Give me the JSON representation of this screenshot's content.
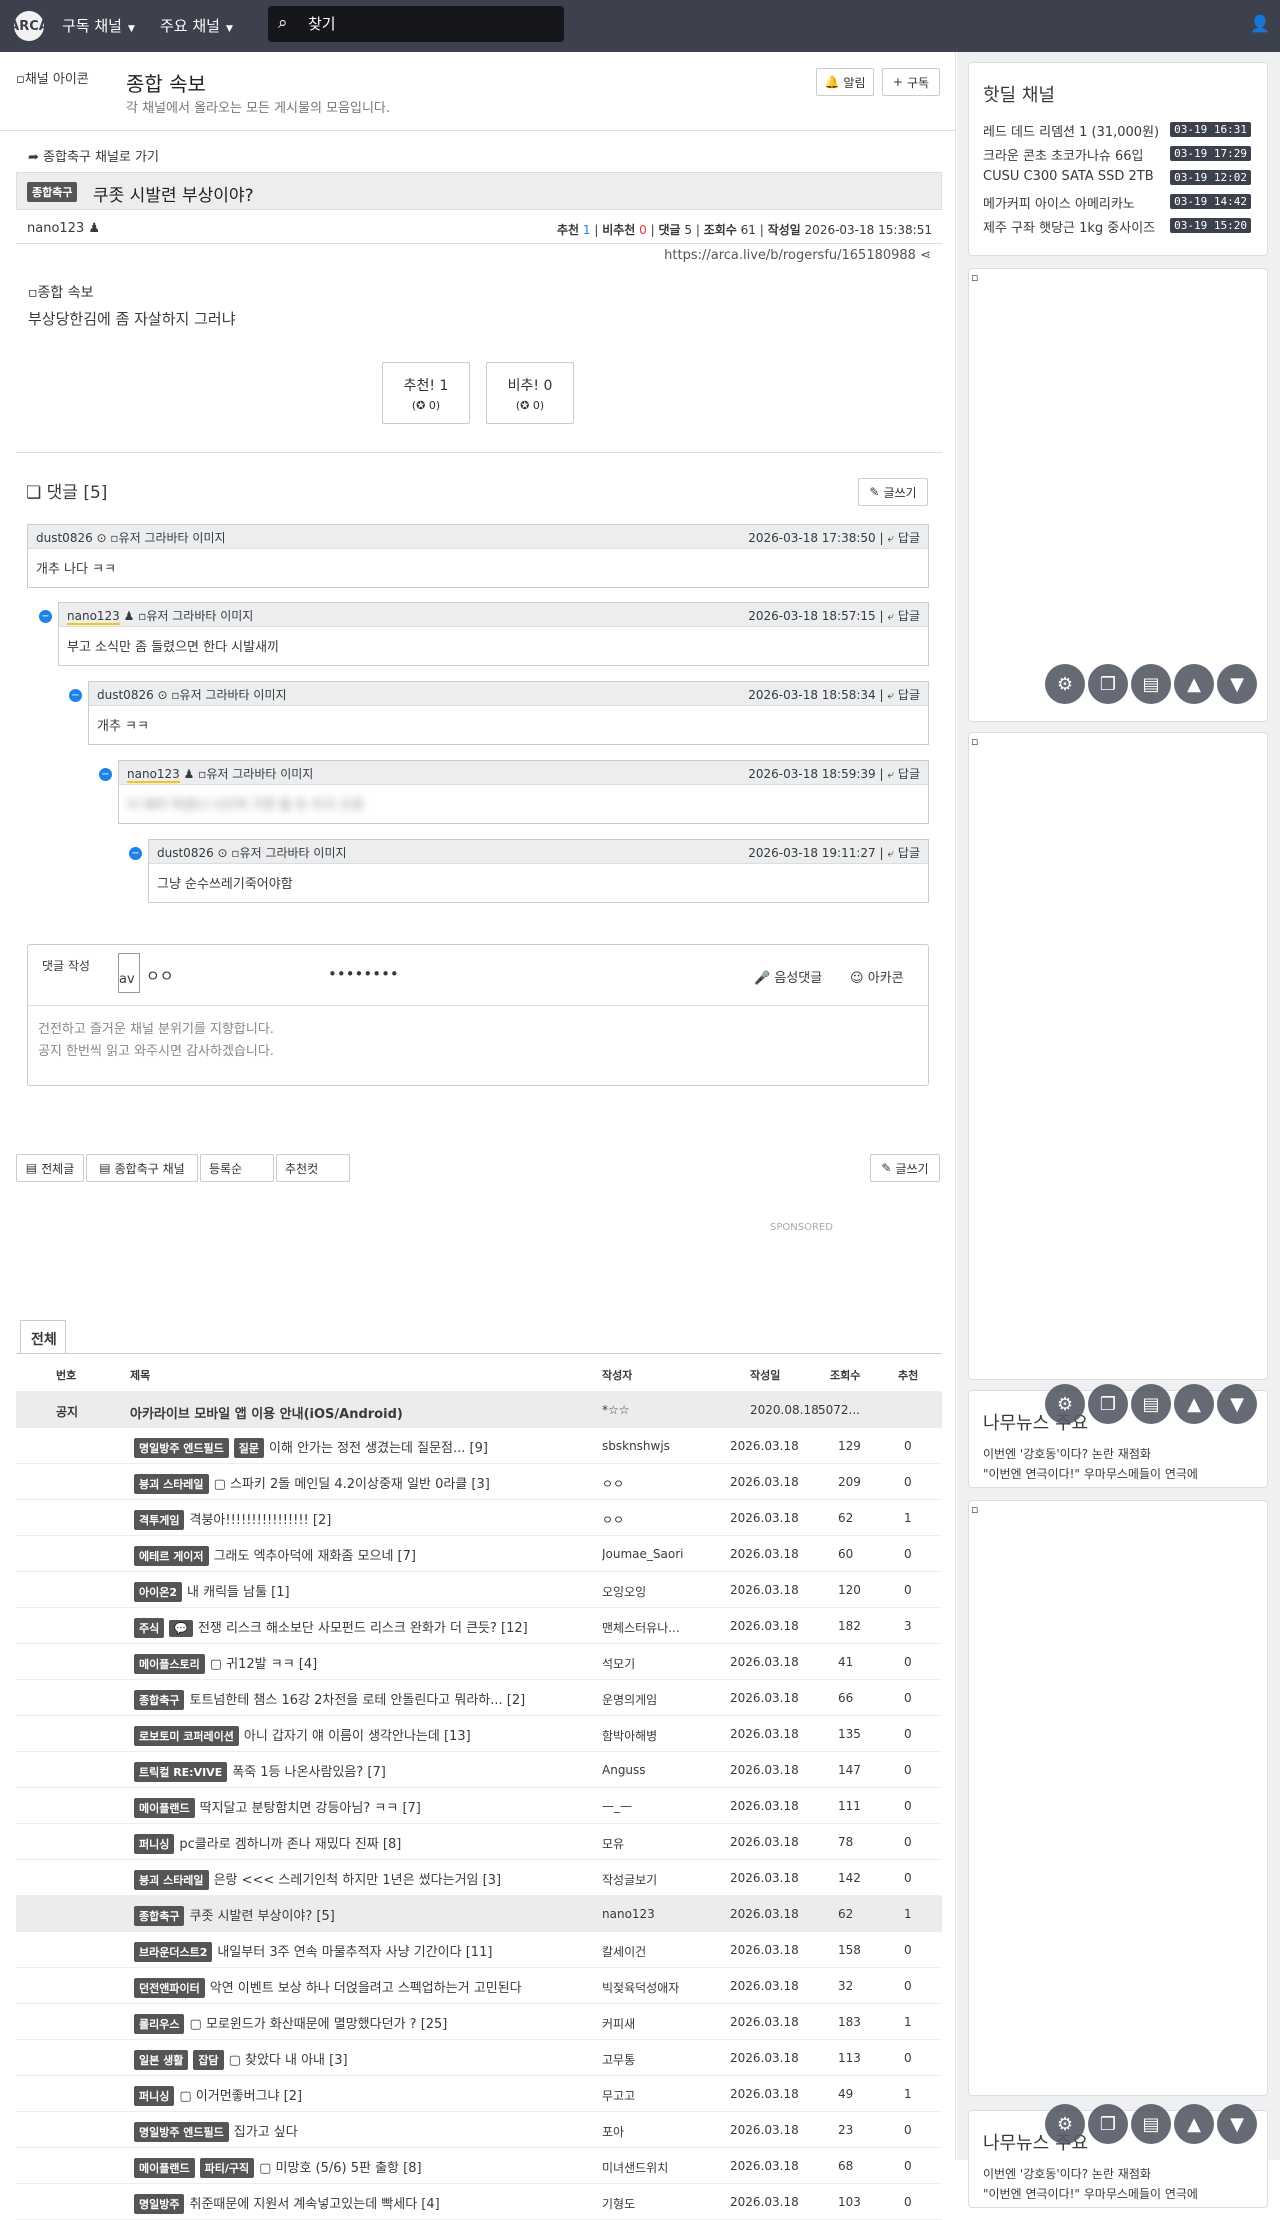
{
  "nav": {
    "logo": "ARCA",
    "subscribed": "구독 채널",
    "major": "주요 채널",
    "search_placeholder": "찾기"
  },
  "channel": {
    "icon_alt": "채널 아이콘",
    "title": "종합 속보",
    "desc": "각 채널에서 올라오는 모든 게시물의 모음입니다.",
    "alarm": "알림",
    "subscribe": "구독"
  },
  "post": {
    "goto": "종합축구 채널로 가기",
    "category": "종합축구",
    "title": "쿠좃 시발련 부상이야?",
    "author": "nano123",
    "meta": {
      "up_label": "추천",
      "up": "1",
      "down_label": "비추천",
      "down": "0",
      "cmt_label": "댓글",
      "cmt": "5",
      "view_label": "조회수",
      "view": "61",
      "date_label": "작성일",
      "date": "2026-03-18 15:38:51"
    },
    "url": "https://arca.live/b/rogersfu/165180988",
    "img_alt": "종합 속보",
    "body": "부상당한김에 좀 자살하지 그러냐",
    "vote_up": "추천! 1",
    "vote_up_sub": "(✪ 0)",
    "vote_down": "비추! 0",
    "vote_down_sub": "(✪ 0)"
  },
  "comments": {
    "title": "댓글 [5]",
    "write": "글쓰기",
    "reply": "답글",
    "avatar_alt": "유저 그라바타 이미지",
    "items": [
      {
        "author": "dust0826",
        "date": "2026-03-18 17:38:50",
        "text": "개추 나다 ㅋㅋ"
      },
      {
        "author": "nano123",
        "date": "2026-03-18 18:57:15",
        "text": "부고 소식만 좀 들렸으면 한다 시발새끼"
      },
      {
        "author": "dust0826",
        "date": "2026-03-18 18:58:34",
        "text": "개추 ㅋㅋ"
      },
      {
        "author": "nano123",
        "date": "2026-03-18 18:59:39",
        "text": "다 테러 하겠냐 시간씩 가면 될 듯 자극 신경"
      },
      {
        "author": "dust0826",
        "date": "2026-03-18 19:11:27",
        "text": "그냥 순수쓰레기죽어야함"
      }
    ]
  },
  "compose": {
    "label": "댓글 작성",
    "avatar": "av",
    "name": "ㅇㅇ",
    "password": "••••••••",
    "voice": "음성댓글",
    "arcacon": "아카콘",
    "placeholder1": "건전하고 즐거운 채널 분위기를 지향합니다.",
    "placeholder2": "공지 한번씩 읽고 와주시면 감사하겠습니다."
  },
  "filters": {
    "all": "전체글",
    "channel": "종합축구 채널",
    "sort": "등록순",
    "recommend": "추천컷",
    "write": "글쓰기"
  },
  "sponsored": "SPONSORED",
  "board": {
    "tab": "전체",
    "headers": {
      "no": "번호",
      "title": "제목",
      "author": "작성자",
      "date": "작성일",
      "views": "조회수",
      "rec": "추천"
    },
    "notice": {
      "no": "공지",
      "title": "아카라이브 모바일 앱 이용 안내(iOS/Android)",
      "author": "*☆☆",
      "date": "2020.08.18",
      "views": "5072...",
      "rec": ""
    },
    "rows": [
      {
        "cat": "명일방주 엔드필드",
        "cat2": "질문",
        "title": "이해 안가는 정전 생겼는데 질문점... [9]",
        "author": "sbsknshwjs",
        "date": "2026.03.18",
        "views": "129",
        "rec": "0"
      },
      {
        "cat": "붕괴 스타레일",
        "cat2": "",
        "title": "▢ 스파키 2돌 메인딜 4.2이상중재 일반 0라클 [3]",
        "author": "ㅇㅇ",
        "date": "2026.03.18",
        "views": "209",
        "rec": "0"
      },
      {
        "cat": "격투게임",
        "cat2": "",
        "title": "격붕아!!!!!!!!!!!!!!!! [2]",
        "author": "ㅇㅇ",
        "date": "2026.03.18",
        "views": "62",
        "rec": "1"
      },
      {
        "cat": "에테르 게이저",
        "cat2": "",
        "title": "그래도 엑추아덕에 재화좀 모으네 [7]",
        "author": "Joumae_Saori",
        "date": "2026.03.18",
        "views": "60",
        "rec": "0"
      },
      {
        "cat": "아이온2",
        "cat2": "",
        "title": "내 캐릭들 남툴 [1]",
        "author": "오잉오잉",
        "date": "2026.03.18",
        "views": "120",
        "rec": "0"
      },
      {
        "cat": "주식",
        "cat2": "💬",
        "title": "전쟁 리스크 해소보단 사모펀드 리스크 완화가 더 큰듯? [12]",
        "author": "맨체스터유나...",
        "date": "2026.03.18",
        "views": "182",
        "rec": "3"
      },
      {
        "cat": "메이플스토리",
        "cat2": "",
        "title": "▢ 귀12발 ㅋㅋ [4]",
        "author": "석모기",
        "date": "2026.03.18",
        "views": "41",
        "rec": "0"
      },
      {
        "cat": "종합축구",
        "cat2": "",
        "title": "토트넘한테 챔스 16강 2차전을 로테 안돌린다고 뭐라하... [2]",
        "author": "운명의게임",
        "date": "2026.03.18",
        "views": "66",
        "rec": "0"
      },
      {
        "cat": "로보토미 코퍼레이션",
        "cat2": "",
        "title": "아니 갑자기 얘 이름이 생각안나는데 [13]",
        "author": "함박아해병",
        "date": "2026.03.18",
        "views": "135",
        "rec": "0"
      },
      {
        "cat": "트릭컬 RE:VIVE",
        "cat2": "",
        "title": "폭죽 1등 나온사람있음? [7]",
        "author": "Anguss",
        "date": "2026.03.18",
        "views": "147",
        "rec": "0"
      },
      {
        "cat": "메이플랜드",
        "cat2": "",
        "title": "딱지달고 분탕함치면 강등아님? ㅋㅋ [7]",
        "author": "—_—",
        "date": "2026.03.18",
        "views": "111",
        "rec": "0"
      },
      {
        "cat": "퍼니싱",
        "cat2": "",
        "title": "pc클라로 겜하니까 존나 재밌다 진짜 [8]",
        "author": "모유",
        "date": "2026.03.18",
        "views": "78",
        "rec": "0"
      },
      {
        "cat": "붕괴 스타레일",
        "cat2": "",
        "title": "은랑 <<< 스레기인척 하지만 1년은 썼다는거임 [3]",
        "author": "작성글보기",
        "date": "2026.03.18",
        "views": "142",
        "rec": "0"
      },
      {
        "cat": "종합축구",
        "cat2": "",
        "title": "쿠좃 시발련 부상이야? [5]",
        "author": "nano123",
        "date": "2026.03.18",
        "views": "62",
        "rec": "1",
        "hl": true
      },
      {
        "cat": "브라운더스트2",
        "cat2": "",
        "title": "내일부터 3주 연속 마물추적자 사냥 기간이다 [11]",
        "author": "칼세이건",
        "date": "2026.03.18",
        "views": "158",
        "rec": "0"
      },
      {
        "cat": "던전앤파이터",
        "cat2": "",
        "title": "악연 이벤트 보상 하나 더얹을려고 스펙업하는거 고민된다",
        "author": "빅젖육덕성애자",
        "date": "2026.03.18",
        "views": "32",
        "rec": "0"
      },
      {
        "cat": "롤리우스",
        "cat2": "",
        "title": "▢ 모로윈드가 화산때문에 멸망했다던가 ? [25]",
        "author": "커피새",
        "date": "2026.03.18",
        "views": "183",
        "rec": "1"
      },
      {
        "cat": "일본 생활",
        "cat2": "잡담",
        "title": "▢ 찾았다 내 아내 [3]",
        "author": "고무통",
        "date": "2026.03.18",
        "views": "113",
        "rec": "0"
      },
      {
        "cat": "퍼니싱",
        "cat2": "",
        "title": "▢ 이거먼좋버그냐 [2]",
        "author": "무고고",
        "date": "2026.03.18",
        "views": "49",
        "rec": "1"
      },
      {
        "cat": "명일방주 엔드필드",
        "cat2": "",
        "title": "집가고 싶다",
        "author": "포아",
        "date": "2026.03.18",
        "views": "23",
        "rec": "0"
      },
      {
        "cat": "메이플랜드",
        "cat2": "파티/구직",
        "title": "▢ 미망호 (5/6) 5판 출항 [8]",
        "author": "미녀샌드위치",
        "date": "2026.03.18",
        "views": "68",
        "rec": "0"
      },
      {
        "cat": "명일방주",
        "cat2": "",
        "title": "취준때문에 지원서 계속넣고있는데 빡세다 [4]",
        "author": "기형도",
        "date": "2026.03.18",
        "views": "103",
        "rec": "0"
      }
    ]
  },
  "sidebar": {
    "hotdeal_title": "핫딜 채널",
    "deals": [
      {
        "title": "레드 데드 리뎀션 1 (31,000원)",
        "time": "03-19 16:31"
      },
      {
        "title": "크라운 콘초 초코가나슈 66입",
        "time": "03-19 17:29"
      },
      {
        "title": "CUSU C300 SATA SSD 2TB",
        "time": "03-19 12:02"
      },
      {
        "title": "메가커피 아이스 아메리카노",
        "time": "03-19 14:42"
      },
      {
        "title": "제주 구좌 햇당근 1kg 중사이즈",
        "time": "03-19 15:20"
      }
    ],
    "news_title": "나무뉴스 주요",
    "news_line1": "이번엔 '강호동'이다? 논란 재점화",
    "news_line2": "\"이번엔 연극이다!\" 우마무스메들이 연극에"
  }
}
